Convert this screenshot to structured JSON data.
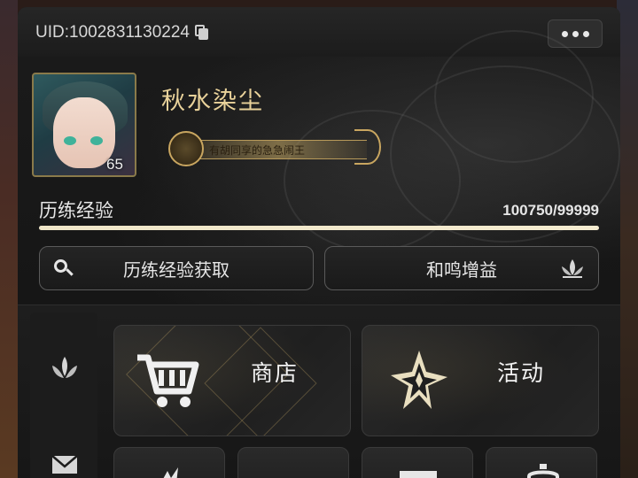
{
  "header": {
    "uid_text": "UID:1002831130224",
    "copy_icon": "copy-icon",
    "more_icon": "more-dots-icon"
  },
  "profile": {
    "player_name": "秋水染尘",
    "level": "65",
    "title_text": "有胡同享的急急闹王",
    "avatar": "character-portrait"
  },
  "experience": {
    "label": "历练经验",
    "value_text": "100750/99999",
    "fill_fraction": 1.0
  },
  "actions": {
    "get_exp_label": "历练经验获取",
    "resonance_label": "和鸣增益",
    "get_exp_icon": "search-icon",
    "resonance_icon": "lotus-icon"
  },
  "side_nav": {
    "items": [
      {
        "icon": "lotus-emblem-icon"
      },
      {
        "icon": "mail-icon"
      }
    ]
  },
  "tiles": {
    "shop": {
      "label": "商店",
      "icon": "cart-icon"
    },
    "event": {
      "label": "活动",
      "icon": "star-emblem-icon"
    }
  },
  "colors": {
    "accent_gold": "#e9d29a",
    "panel_bg": "#141414",
    "text_light": "#e6e6e6"
  }
}
